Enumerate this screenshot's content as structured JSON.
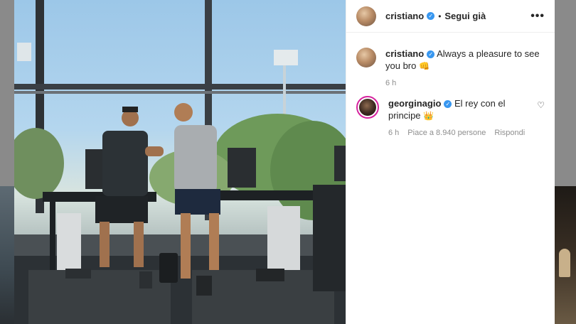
{
  "post": {
    "author": "cristiano",
    "header_follow": "Segui già",
    "header_dot": "•",
    "more_icon": "•••"
  },
  "comments": [
    {
      "username": "cristiano",
      "text": "Always a pleasure to see you bro",
      "emoji": "👊",
      "time": "6 h",
      "likes": "",
      "reply": ""
    },
    {
      "username": "georginagio",
      "text": "El rey con el principe",
      "emoji": "👑",
      "time": "6 h",
      "likes": "Piace a 8.940 persone",
      "reply": "Rispondi"
    }
  ],
  "colors": {
    "verified": "#3897f0",
    "story_ring": "#d6249f",
    "text": "#262626",
    "muted": "#8e8e8e"
  },
  "icons": {
    "verified": "verified-badge-icon",
    "heart": "heart-outline-icon",
    "more": "more-options-icon"
  }
}
